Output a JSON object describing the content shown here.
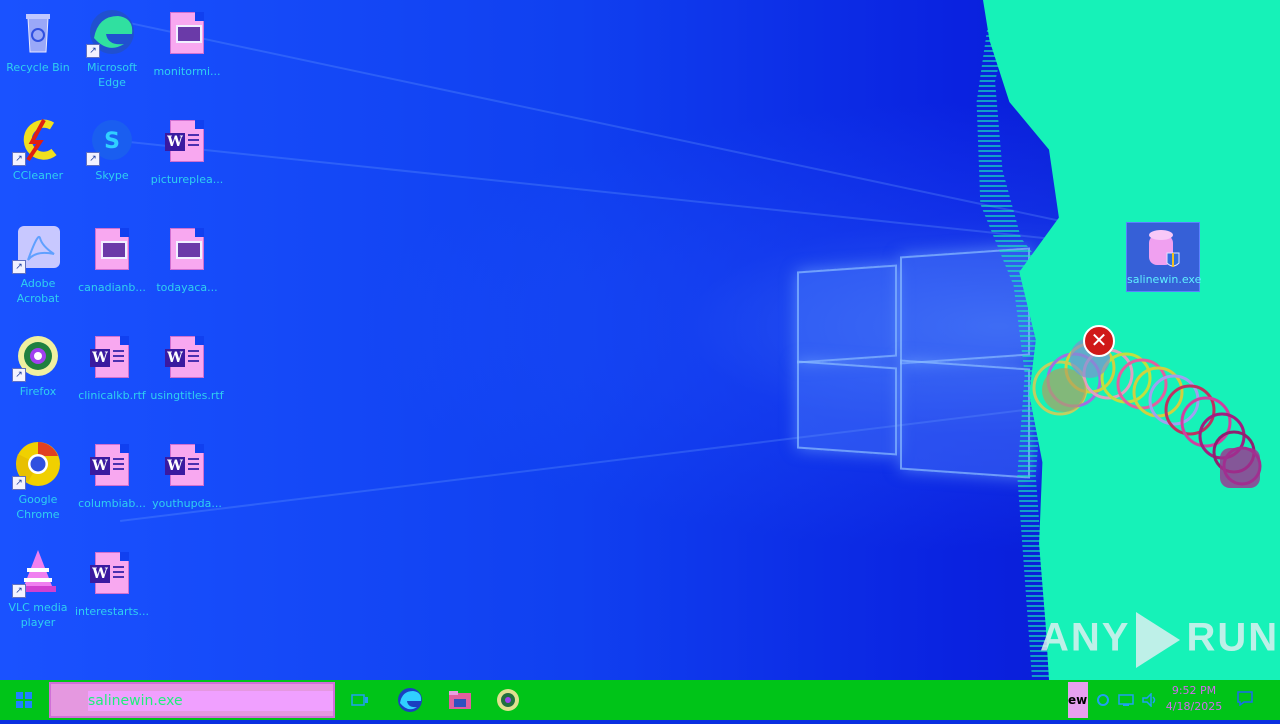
{
  "desktop_icons": [
    {
      "id": "recycle-bin",
      "label": "Recycle Bin",
      "icon": "recycle-bin-icon"
    },
    {
      "id": "microsoft-edge",
      "label": "Microsoft Edge",
      "icon": "edge-icon"
    },
    {
      "id": "monitormi",
      "label": "monitormi...",
      "icon": "image-file-icon"
    },
    {
      "id": "ccleaner",
      "label": "CCleaner",
      "icon": "ccleaner-icon"
    },
    {
      "id": "skype",
      "label": "Skype",
      "icon": "skype-icon"
    },
    {
      "id": "picturepl",
      "label": "picturepleа...",
      "icon": "word-doc-icon"
    },
    {
      "id": "adobe-acrobat",
      "label": "Adobe Acrobat",
      "icon": "acrobat-icon"
    },
    {
      "id": "canadianb",
      "label": "canadianb...",
      "icon": "image-file-icon"
    },
    {
      "id": "todayaca",
      "label": "todayaca...",
      "icon": "image-file-icon"
    },
    {
      "id": "firefox",
      "label": "Firefox",
      "icon": "firefox-icon"
    },
    {
      "id": "clinicalkb",
      "label": "clinicalkb.rtf",
      "icon": "word-doc-icon"
    },
    {
      "id": "usingtitles",
      "label": "usingtitles.rtf",
      "icon": "word-doc-icon"
    },
    {
      "id": "google-chrome",
      "label": "Google Chrome",
      "icon": "chrome-icon"
    },
    {
      "id": "columbiab",
      "label": "columbiab...",
      "icon": "word-doc-icon"
    },
    {
      "id": "youthupda",
      "label": "youthupda...",
      "icon": "word-doc-icon"
    },
    {
      "id": "vlc",
      "label": "VLC media player",
      "icon": "vlc-icon"
    },
    {
      "id": "interestarts",
      "label": "interestarts...",
      "icon": "word-doc-icon"
    }
  ],
  "selected_icon": {
    "label": "salinewin.exe",
    "icon": "salinewin-exe-icon"
  },
  "watermark": {
    "left": "ANY",
    "right": "RUN"
  },
  "taskbar": {
    "search_value": "salinewin.exe",
    "running_label": "ewi",
    "clock_time": "9:52 PM",
    "clock_date": "4/18/2025"
  },
  "colors": {
    "taskbar": "#00c418",
    "corrupt_overlay": "#16f2b8",
    "desktop": "#1040f0"
  }
}
